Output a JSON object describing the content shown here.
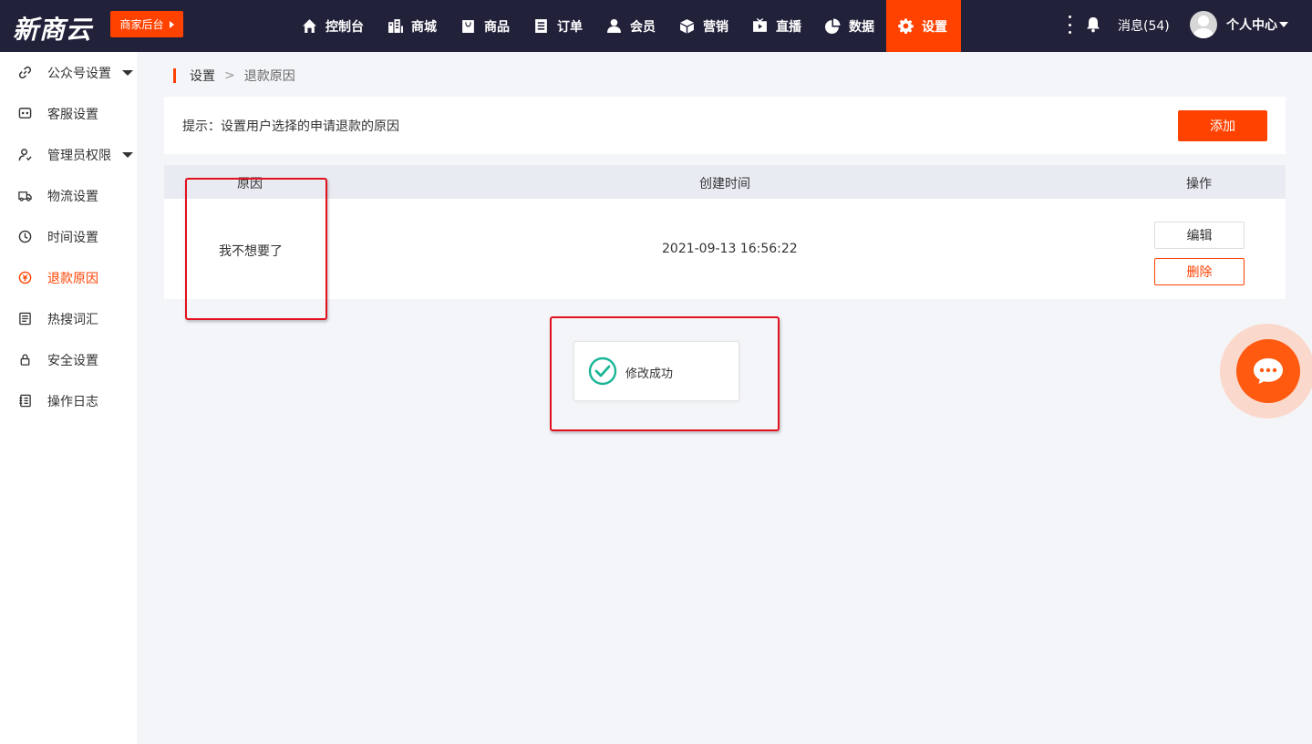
{
  "header": {
    "logo": "新商云",
    "merchant_button": "商家后台",
    "nav": [
      {
        "label": "控制台",
        "icon": "home-icon"
      },
      {
        "label": "商城",
        "icon": "building-icon"
      },
      {
        "label": "商品",
        "icon": "bag-icon"
      },
      {
        "label": "订单",
        "icon": "list-icon"
      },
      {
        "label": "会员",
        "icon": "user-icon"
      },
      {
        "label": "营销",
        "icon": "cube-icon"
      },
      {
        "label": "直播",
        "icon": "tv-icon"
      },
      {
        "label": "数据",
        "icon": "pie-chart-icon"
      },
      {
        "label": "设置",
        "icon": "gear-icon",
        "active": true
      }
    ],
    "messages": "消息(54)",
    "personal_center": "个人中心"
  },
  "sidebar": {
    "items": [
      {
        "label": "公众号设置",
        "icon": "link-icon",
        "expandable": true
      },
      {
        "label": "客服设置",
        "icon": "chat-icon"
      },
      {
        "label": "管理员权限",
        "icon": "admin-icon",
        "expandable": true
      },
      {
        "label": "物流设置",
        "icon": "truck-icon"
      },
      {
        "label": "时间设置",
        "icon": "clock-icon"
      },
      {
        "label": "退款原因",
        "icon": "refund-icon",
        "active": true
      },
      {
        "label": "热搜词汇",
        "icon": "document-icon"
      },
      {
        "label": "安全设置",
        "icon": "lock-icon"
      },
      {
        "label": "操作日志",
        "icon": "log-icon"
      }
    ]
  },
  "breadcrumb": {
    "parent": "设置",
    "separator": ">",
    "current": "退款原因"
  },
  "hint": {
    "text": "提示：设置用户选择的申请退款的原因",
    "add_button": "添加"
  },
  "table": {
    "columns": [
      "原因",
      "创建时间",
      "操作"
    ],
    "rows": [
      {
        "reason": "我不想要了",
        "created_at": "2021-09-13 16:56:22",
        "edit": "编辑",
        "delete": "删除"
      }
    ]
  },
  "toast": {
    "text": "修改成功",
    "icon": "check-circle-icon"
  },
  "colors": {
    "brand": "#ff4200",
    "header_bg": "#22213a",
    "success": "#19b596",
    "annotation": "#e3101e"
  }
}
